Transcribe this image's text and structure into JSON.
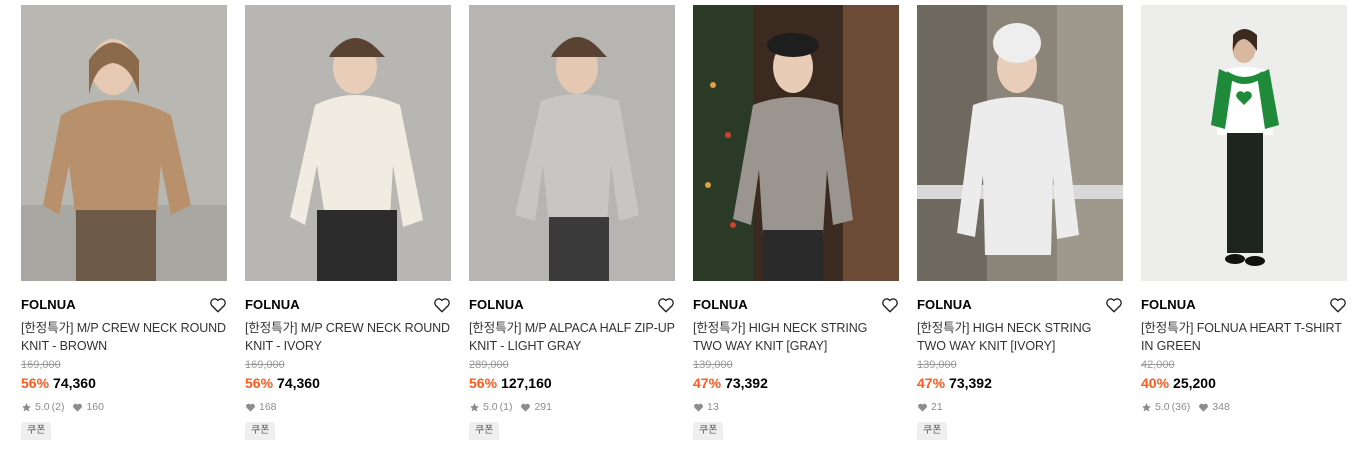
{
  "colors": {
    "discount": "#ff5a1f",
    "muted": "#8c8c8c",
    "tag_bg": "#efefef"
  },
  "products": [
    {
      "brand": "FOLNUA",
      "name": "[한정특가] M/P CREW NECK ROUND KNIT - BROWN",
      "original_price": "169,000",
      "discount": "56%",
      "price": "74,360",
      "rating": "5.0",
      "review_count": "(2)",
      "likes": "160",
      "tag": "쿠폰",
      "image_desc": "model in brown knit sweater"
    },
    {
      "brand": "FOLNUA",
      "name": "[한정특가] M/P CREW NECK ROUND KNIT - IVORY",
      "original_price": "169,000",
      "discount": "56%",
      "price": "74,360",
      "rating": "",
      "review_count": "",
      "likes": "168",
      "tag": "쿠폰",
      "image_desc": "model in ivory knit with cap"
    },
    {
      "brand": "FOLNUA",
      "name": "[한정특가] M/P ALPACA HALF ZIP-UP KNIT - LIGHT GRAY",
      "original_price": "289,000",
      "discount": "56%",
      "price": "127,160",
      "rating": "5.0",
      "review_count": "(1)",
      "likes": "291",
      "tag": "쿠폰",
      "image_desc": "model in light gray half zip knit"
    },
    {
      "brand": "FOLNUA",
      "name": "[한정특가] HIGH NECK STRING TWO WAY KNIT [GRAY]",
      "original_price": "139,000",
      "discount": "47%",
      "price": "73,392",
      "rating": "",
      "review_count": "",
      "likes": "13",
      "tag": "쿠폰",
      "image_desc": "model in gray high neck knit with beret"
    },
    {
      "brand": "FOLNUA",
      "name": "[한정특가] HIGH NECK STRING TWO WAY KNIT [IVORY]",
      "original_price": "139,000",
      "discount": "47%",
      "price": "73,392",
      "rating": "",
      "review_count": "",
      "likes": "21",
      "tag": "쿠폰",
      "image_desc": "model in ivory high neck knit outdoors"
    },
    {
      "brand": "FOLNUA",
      "name": "[한정특가] FOLNUA HEART T-SHIRT IN GREEN",
      "original_price": "42,000",
      "discount": "40%",
      "price": "25,200",
      "rating": "5.0",
      "review_count": "(36)",
      "likes": "348",
      "tag": "",
      "image_desc": "model in heart t-shirt with green sweater"
    }
  ]
}
